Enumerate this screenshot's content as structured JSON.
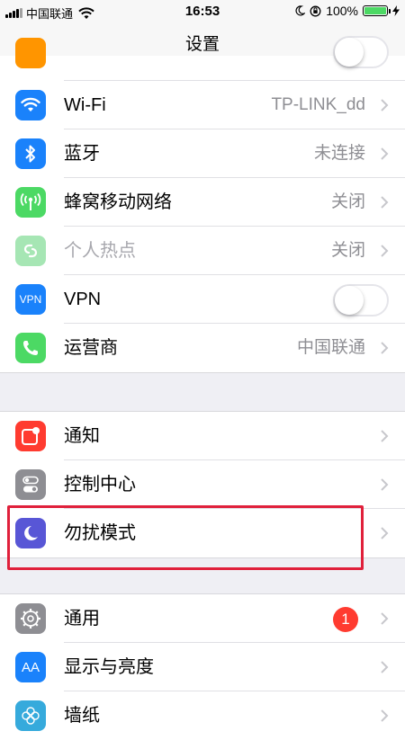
{
  "status_bar": {
    "carrier": "中国联通",
    "time": "16:53",
    "battery": "100%",
    "battery_level": 1.0
  },
  "nav": {
    "title": "设置"
  },
  "group1": {
    "items": [
      {
        "label": "Wi-Fi",
        "value": "TP-LINK_dd",
        "icon": "wifi-icon",
        "color": "#1a82fb"
      },
      {
        "label": "蓝牙",
        "value": "未连接",
        "icon": "bluetooth-icon",
        "color": "#1a82fb"
      },
      {
        "label": "蜂窝移动网络",
        "value": "关闭",
        "icon": "antenna-icon",
        "color": "#4cd964"
      },
      {
        "label": "个人热点",
        "value": "关闭",
        "icon": "hotspot-icon",
        "color": "#a6e6b4"
      },
      {
        "label": "VPN",
        "icon_text": "VPN",
        "icon": "vpn-icon",
        "color": "#1a82fb",
        "toggle_on": false
      },
      {
        "label": "运营商",
        "value": "中国联通",
        "icon": "phone-icon",
        "color": "#4cd964"
      }
    ]
  },
  "group2": {
    "items": [
      {
        "label": "通知",
        "icon": "notification-icon",
        "color": "#ff3b30"
      },
      {
        "label": "控制中心",
        "icon": "control-center-icon",
        "color": "#8e8e93"
      },
      {
        "label": "勿扰模式",
        "icon": "moon-icon",
        "color": "#5856d6"
      }
    ]
  },
  "group3": {
    "items": [
      {
        "label": "通用",
        "badge": "1",
        "icon": "gear-icon",
        "color": "#8e8e93"
      },
      {
        "label": "显示与亮度",
        "icon_text": "AA",
        "icon": "display-icon",
        "color": "#1a82fb"
      },
      {
        "label": "墙纸",
        "icon": "wallpaper-icon",
        "color": "#36aadc"
      }
    ]
  }
}
